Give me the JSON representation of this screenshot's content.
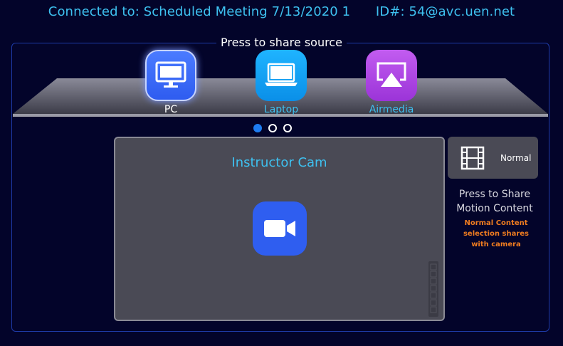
{
  "header": {
    "connected_label": "Connected to:",
    "meeting_name": "Scheduled Meeting 7/13/2020 1",
    "id_label": "ID#:",
    "id_value": "54@avc.uen.net"
  },
  "share": {
    "title": "Press to share source",
    "sources": [
      {
        "label": "PC",
        "icon": "monitor-icon",
        "selected": true,
        "color": "#3b6df7"
      },
      {
        "label": "Laptop",
        "icon": "laptop-icon",
        "selected": false,
        "color": "#149ff5"
      },
      {
        "label": "Airmedia",
        "icon": "airplay-icon",
        "selected": false,
        "color": "#b048e6"
      }
    ],
    "page_indicator": {
      "pages": 3,
      "active": 1
    }
  },
  "camera": {
    "title": "Instructor Cam",
    "icon": "video-camera-icon"
  },
  "motion": {
    "button_label": "Normal",
    "button_icon": "film-strip-icon",
    "caption": "Press to Share Motion Content",
    "note": "Normal Content selection shares with camera"
  },
  "colors": {
    "background": "#03042a",
    "accent_text": "#3ec1f0",
    "note": "#f07d20",
    "panel_border": "#1e3ba8"
  }
}
